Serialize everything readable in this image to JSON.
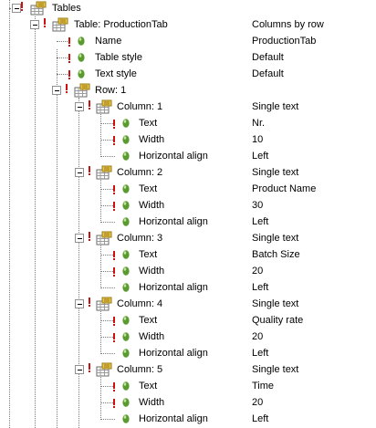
{
  "tree": {
    "root": {
      "label": "Tables",
      "expanded": true,
      "icon": "table-folder-icon"
    },
    "table": {
      "label": "Table: ProductionTab",
      "value": "Columns by row",
      "expanded": true,
      "icon": "table-folder-icon"
    },
    "table_props": [
      {
        "label": "Name",
        "value": "ProductionTab",
        "icon": "property-icon"
      },
      {
        "label": "Table style",
        "value": "Default",
        "icon": "property-icon"
      },
      {
        "label": "Text style",
        "value": "Default",
        "icon": "property-icon"
      }
    ],
    "row": {
      "label": "Row: 1",
      "value": "",
      "expanded": true,
      "icon": "table-folder-icon"
    },
    "columns": [
      {
        "label": "Column: 1",
        "value": "Single text",
        "props": [
          {
            "label": "Text",
            "value": "Nr."
          },
          {
            "label": "Width",
            "value": "10"
          },
          {
            "label": "Horizontal align",
            "value": "Left"
          }
        ]
      },
      {
        "label": "Column: 2",
        "value": "Single text",
        "props": [
          {
            "label": "Text",
            "value": "Product Name"
          },
          {
            "label": "Width",
            "value": "30"
          },
          {
            "label": "Horizontal align",
            "value": "Left"
          }
        ]
      },
      {
        "label": "Column: 3",
        "value": "Single text",
        "props": [
          {
            "label": "Text",
            "value": "Batch Size"
          },
          {
            "label": "Width",
            "value": "20"
          },
          {
            "label": "Horizontal align",
            "value": "Left"
          }
        ]
      },
      {
        "label": "Column: 4",
        "value": "Single text",
        "props": [
          {
            "label": "Text",
            "value": "Quality rate"
          },
          {
            "label": "Width",
            "value": "20"
          },
          {
            "label": "Horizontal align",
            "value": "Left"
          }
        ]
      },
      {
        "label": "Column: 5",
        "value": "Single text",
        "props": [
          {
            "label": "Text",
            "value": "Time"
          },
          {
            "label": "Width",
            "value": "20"
          },
          {
            "label": "Horizontal align",
            "value": "Left"
          }
        ]
      }
    ]
  },
  "colors": {
    "connector": "#808080",
    "required_marker": "#cc1111",
    "property_bullet": "#5a9a2e",
    "folder": "#e8c44a"
  }
}
